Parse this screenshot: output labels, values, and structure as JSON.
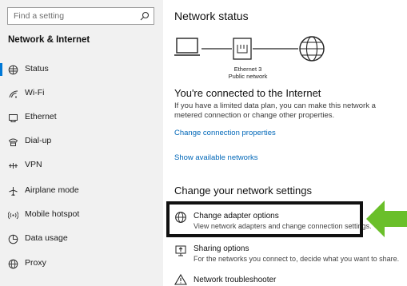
{
  "sidebar": {
    "search_placeholder": "Find a setting",
    "section_title": "Network & Internet",
    "items": [
      {
        "label": "Status",
        "icon": "status-globe-icon"
      },
      {
        "label": "Wi-Fi",
        "icon": "wifi-icon"
      },
      {
        "label": "Ethernet",
        "icon": "ethernet-icon"
      },
      {
        "label": "Dial-up",
        "icon": "dialup-icon"
      },
      {
        "label": "VPN",
        "icon": "vpn-icon"
      },
      {
        "label": "Airplane mode",
        "icon": "airplane-icon"
      },
      {
        "label": "Mobile hotspot",
        "icon": "hotspot-icon"
      },
      {
        "label": "Data usage",
        "icon": "data-usage-icon"
      },
      {
        "label": "Proxy",
        "icon": "proxy-globe-icon"
      }
    ]
  },
  "main": {
    "title": "Network status",
    "diagram": {
      "adapter_name": "Ethernet 3",
      "network_type": "Public network"
    },
    "connected_heading": "You're connected to the Internet",
    "connected_desc_1": "If you have a limited data plan, you can make this network a",
    "connected_desc_2": "metered connection or change other properties.",
    "link_change_props": "Change connection properties",
    "link_show_networks": "Show available networks",
    "change_heading": "Change your network settings",
    "options": [
      {
        "title": "Change adapter options",
        "subtitle": "View network adapters and change connection settings."
      },
      {
        "title": "Sharing options",
        "subtitle": "For the networks you connect to, decide what you want to share."
      },
      {
        "title": "Network troubleshooter",
        "subtitle": ""
      }
    ]
  },
  "colors": {
    "accent": "#0078d7",
    "link": "#0067b8",
    "arrow": "#6abf2a",
    "highlight_border": "#111111"
  }
}
